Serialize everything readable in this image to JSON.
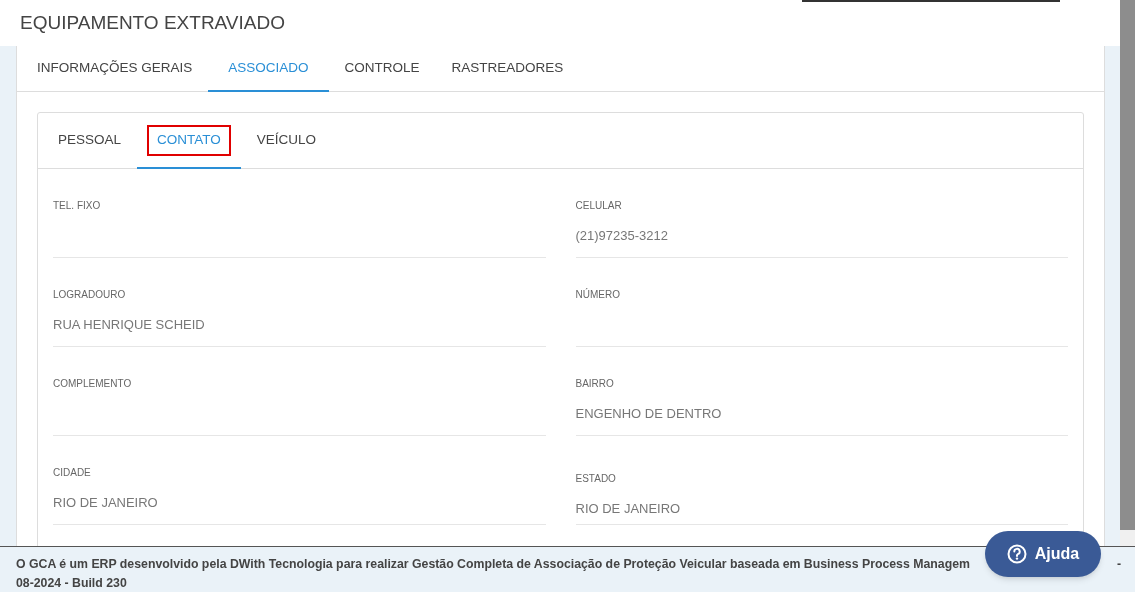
{
  "window": {
    "title": "EQUIPAMENTO EXTRAVIADO"
  },
  "tabs": [
    {
      "label": "INFORMAÇÕES GERAIS",
      "selected": false
    },
    {
      "label": "ASSOCIADO",
      "selected": true
    },
    {
      "label": "CONTROLE",
      "selected": false
    },
    {
      "label": "RASTREADORES",
      "selected": false
    }
  ],
  "subtabs": [
    {
      "label": "PESSOAL",
      "selected": false,
      "highlighted": false
    },
    {
      "label": "CONTATO",
      "selected": true,
      "highlighted": true
    },
    {
      "label": "VEÍCULO",
      "selected": false,
      "highlighted": false
    }
  ],
  "fields": [
    {
      "label": "TEL. FIXO"
    },
    {
      "label": "CELULAR",
      "value": "(21)97235-3212"
    },
    {
      "label": "LOGRADOURO",
      "value": "RUA HENRIQUE SCHEID"
    },
    {
      "label": "NÚMERO"
    },
    {
      "label": "COMPLEMENTO"
    },
    {
      "label": "BAIRRO",
      "value": "ENGENHO DE DENTRO"
    },
    {
      "label": "CIDADE",
      "value": "RIO DE JANEIRO"
    },
    {
      "label": "ESTADO",
      "value": "RIO DE JANEIRO"
    }
  ],
  "footer": {
    "line_1": "O GCA é um ERP desenvolvido pela DWith Tecnologia para realizar Gestão Completa de Associação de Proteção Veicular baseada em Business Process Managem",
    "line_1_end": "-",
    "line_2": "08-2024 - Build 230"
  },
  "help_button": {
    "label": "Ajuda"
  }
}
